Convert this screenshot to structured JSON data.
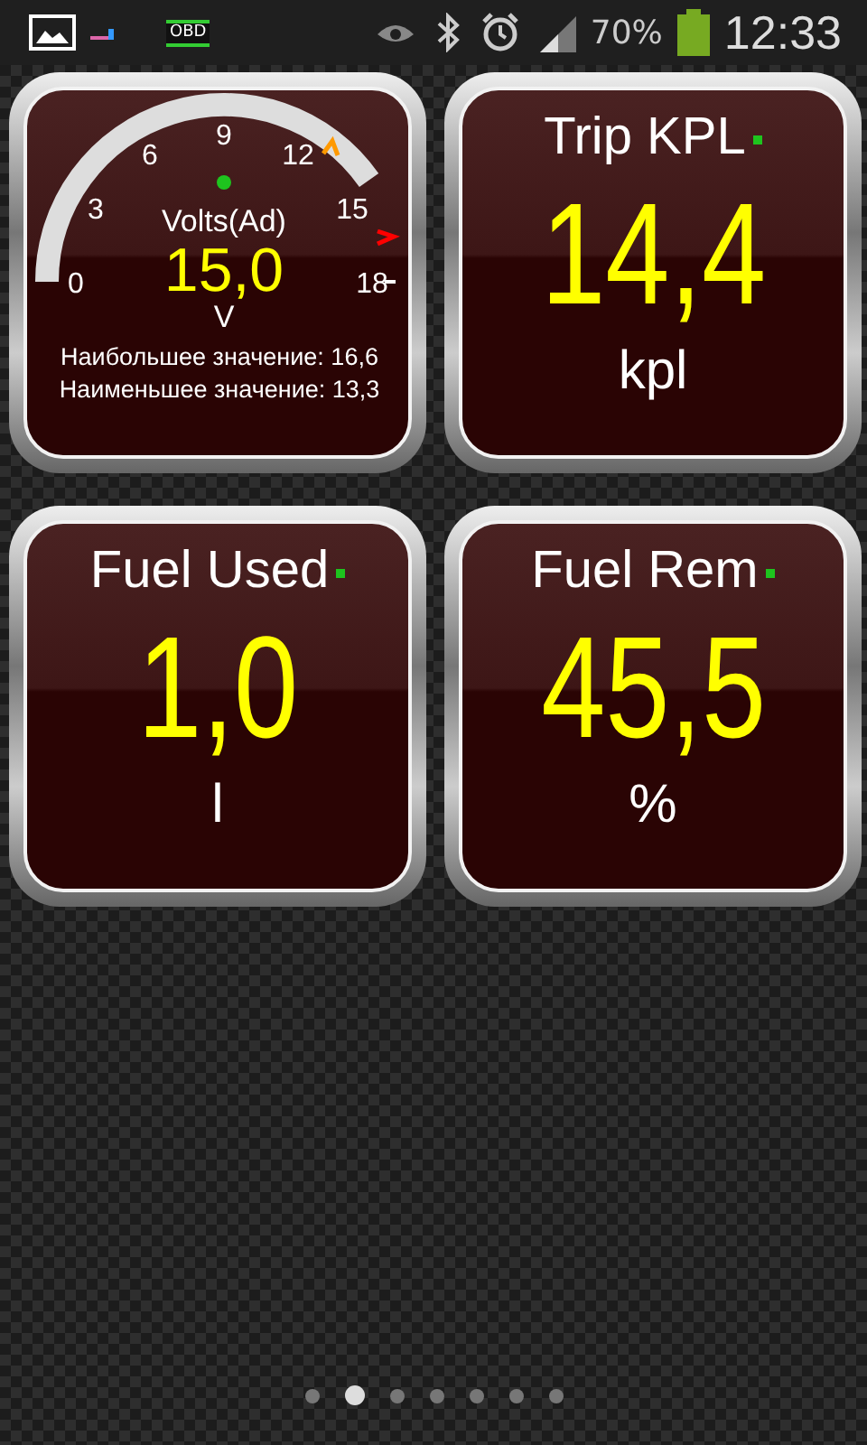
{
  "status_bar": {
    "obd_label": "OBD",
    "battery": "70%",
    "time": "12:33"
  },
  "gauges": [
    {
      "kind": "dial",
      "ticks": [
        "0",
        "3",
        "6",
        "9",
        "12",
        "15",
        "18"
      ],
      "title": "Volts(Ad)",
      "value": "15,0",
      "unit": "V",
      "stats": [
        "Наибольшее значение: 16,6",
        "Наименьшее значение: 13,3"
      ]
    },
    {
      "kind": "digital",
      "title": "Trip KPL",
      "value": "14,4",
      "unit": "kpl"
    },
    {
      "kind": "digital",
      "title": "Fuel Used",
      "value": "1,0",
      "unit": "l"
    },
    {
      "kind": "digital",
      "title": "Fuel Rem",
      "value": "45,5",
      "unit": "%"
    }
  ],
  "pages": [
    {
      "selected": false
    },
    {
      "selected": true
    },
    {
      "selected": false
    },
    {
      "selected": false
    },
    {
      "selected": false
    },
    {
      "selected": false
    },
    {
      "selected": false
    }
  ]
}
